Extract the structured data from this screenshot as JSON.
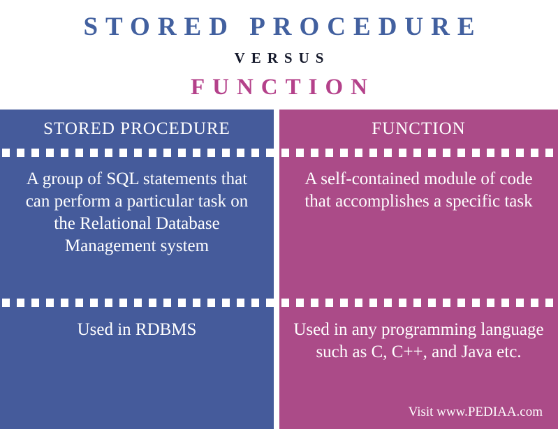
{
  "title": {
    "main": "STORED PROCEDURE",
    "versus": "VERSUS",
    "sub": "FUNCTION"
  },
  "colors": {
    "left_accent": "#42609f",
    "right_accent": "#b4418a",
    "left_panel": "#455b9b",
    "right_panel": "#ab4b88",
    "versus_text": "#15192b",
    "panel_text": "#ffffff",
    "page_background": "#ffffff"
  },
  "comparison": {
    "columns": [
      {
        "header": "STORED PROCEDURE",
        "rows": [
          "A group of SQL statements that can perform a particular task on the Relational Database Management system",
          "Used in RDBMS"
        ]
      },
      {
        "header": "FUNCTION",
        "rows": [
          "A self-contained module of code that accomplishes a specific task",
          "Used in any programming language such as C, C++, and Java etc."
        ]
      }
    ]
  },
  "footer": {
    "visit_text": "Visit www.PEDIAA.com"
  }
}
